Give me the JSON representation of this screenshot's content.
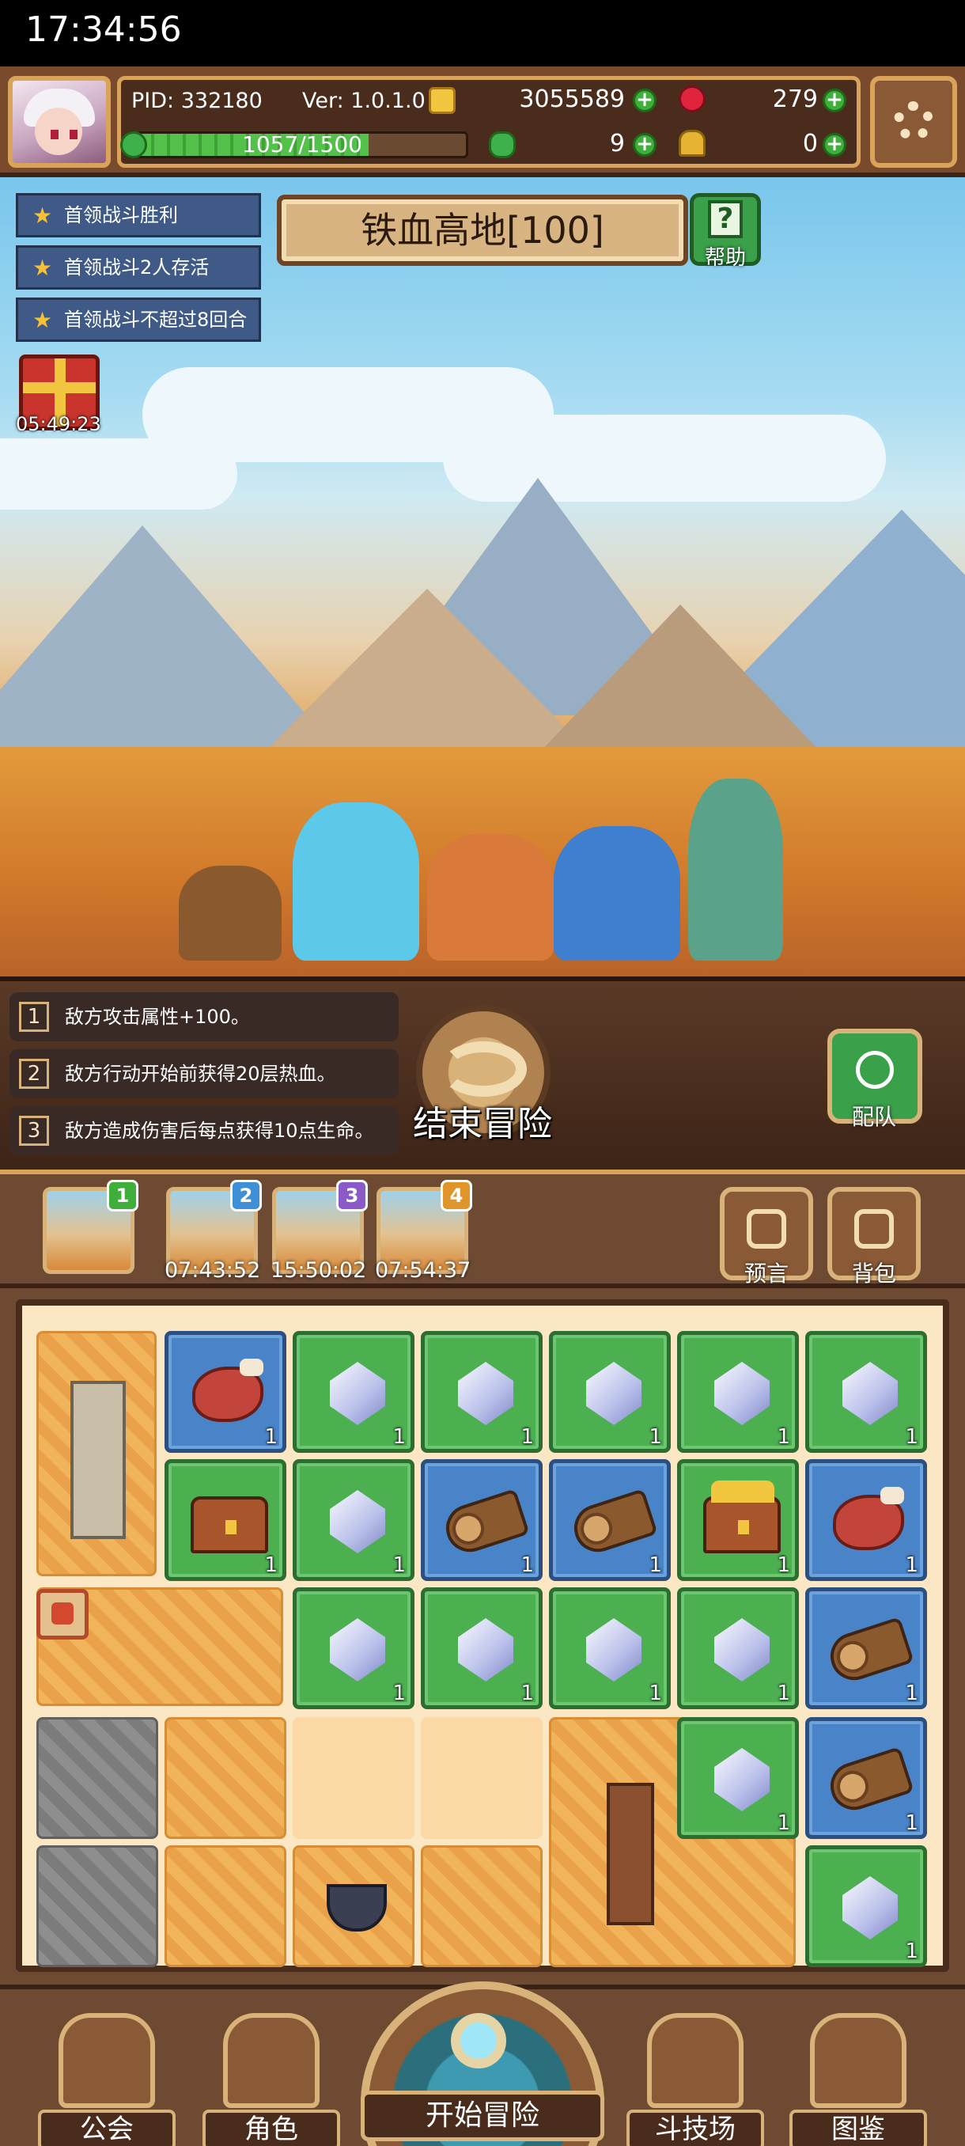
{
  "status_bar": {
    "time": "17:34:56"
  },
  "header": {
    "pid": "PID: 332180",
    "version": "Ver: 1.0.1.0",
    "gold": "3055589",
    "rubies": "279",
    "clovers": "9",
    "keys": "0",
    "energy": {
      "text": "1057/1500",
      "fraction": 0.704
    }
  },
  "quests": [
    "首领战斗胜利",
    "首领战斗2人存活",
    "首领战斗不超过8回合"
  ],
  "stage": {
    "title": "铁血高地[100]",
    "help_label": "帮助"
  },
  "gift": {
    "timer": "05:49:23"
  },
  "effects": [
    {
      "num": "1",
      "text": "敌方攻击属性+100。"
    },
    {
      "num": "2",
      "text": "敌方行动开始前获得20层热血。"
    },
    {
      "num": "3",
      "text": "敌方造成伤害后每点获得10点生命。"
    }
  ],
  "actions": {
    "end_adventure": "结束冒险",
    "team": "配队"
  },
  "slots": [
    {
      "badge": "1",
      "timer": ""
    },
    {
      "badge": "2",
      "timer": "07:43:52"
    },
    {
      "badge": "3",
      "timer": "15:50:02"
    },
    {
      "badge": "4",
      "timer": "07:54:37"
    }
  ],
  "side_buttons": {
    "prophecy": "预言",
    "bag": "背包"
  },
  "inventory": {
    "count_label": "1",
    "items": [
      "meat",
      "crystal",
      "crystal",
      "crystal",
      "crystal",
      "crystal",
      "chest",
      "crystal",
      "log",
      "log",
      "gold-chest",
      "meat",
      "crystal",
      "crystal",
      "crystal",
      "crystal",
      "log",
      "crystal",
      "log",
      "crystal"
    ]
  },
  "bottom_nav": {
    "guild": "公会",
    "character": "角色",
    "start": "开始冒险",
    "arena": "斗技场",
    "codex": "图鉴"
  },
  "colors": {
    "slot_badge_1": "#3fae3a",
    "slot_badge_2": "#3f8fd6",
    "slot_badge_3": "#8a5ac8",
    "slot_badge_4": "#e0952a"
  }
}
